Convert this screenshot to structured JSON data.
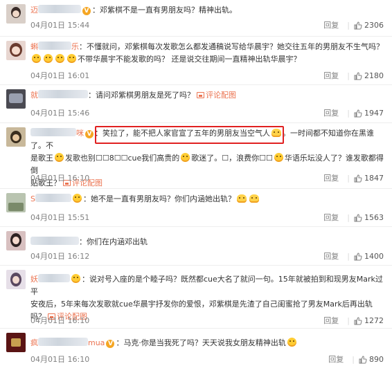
{
  "comments": [
    {
      "name_visible": "迈",
      "text": "邓紫棋不是一直有男朋友吗？精神出轨。",
      "time": "04月01日 15:44",
      "reply": "回复",
      "likes": "2306"
    },
    {
      "name_visible": "蝌",
      "name_suffix": "乐",
      "text1": "不懂就问，邓紫棋每次发歌怎么都发通稿说写给华晨宇？她交往五年的男朋友不生气吗？",
      "text2": "不带华晨宇不能发歌的吗？ 还是说交往期间一直精神出轨华晨宇？",
      "time": "04月01日 16:01",
      "reply": "回复",
      "likes": "2180"
    },
    {
      "name_visible": "就",
      "text": "请问邓紫棋男朋友是死了吗？",
      "pic_link": "评论配图",
      "time": "04月01日 15:46",
      "reply": "回复",
      "likes": "1947"
    },
    {
      "name_visible": "咪",
      "text1a": "笑拉了，能不把人家官宣了五年的男朋友当空气人",
      "text1b": "。一时间都不知道你在黑谁了。不",
      "text2": "是歌王",
      "text2b": "发歌也别☐☐8☐☐cue我们高贵的",
      "text2c": "歌迷了。☐，浪费你☐☐",
      "text2d": "华语乐坛没人了？谁发歌都得倒",
      "text3": "贴歌王？",
      "pic_link": "评论配图",
      "time": "04月01日 16:10",
      "reply": "回复",
      "likes": "1847"
    },
    {
      "name_visible": "S",
      "text": "她不是一直有男朋友吗？你们内涵她出轨？",
      "time": "04月01日 15:51",
      "reply": "回复",
      "likes": "1563"
    },
    {
      "name_visible": "",
      "text": "你们在内涵邓出轨",
      "time": "04月01日 16:12",
      "reply": "回复",
      "likes": "1400"
    },
    {
      "name_visible": "妖",
      "text1": "说对号入座的是个睦子吗？既然都cue大名了就问一句。15年就被拍到和现男友Mark过平",
      "text2": "安夜后，5年来每次发歌就cue华晨宇抒发你的爱恨，邓紫棋是先渣了自己闺蜜抢了男友Mark后再出轨吗？",
      "pic_link": "评论配图",
      "time": "04月01日 16:10",
      "reply": "回复",
      "likes": "1272"
    },
    {
      "name_visible": "疯",
      "name_suffix": "mua",
      "text": "马克·你是当我死了吗？天天说我女朋友精神出轨",
      "time": "04月01日 16:10",
      "reply": "回复",
      "likes": "890"
    }
  ]
}
